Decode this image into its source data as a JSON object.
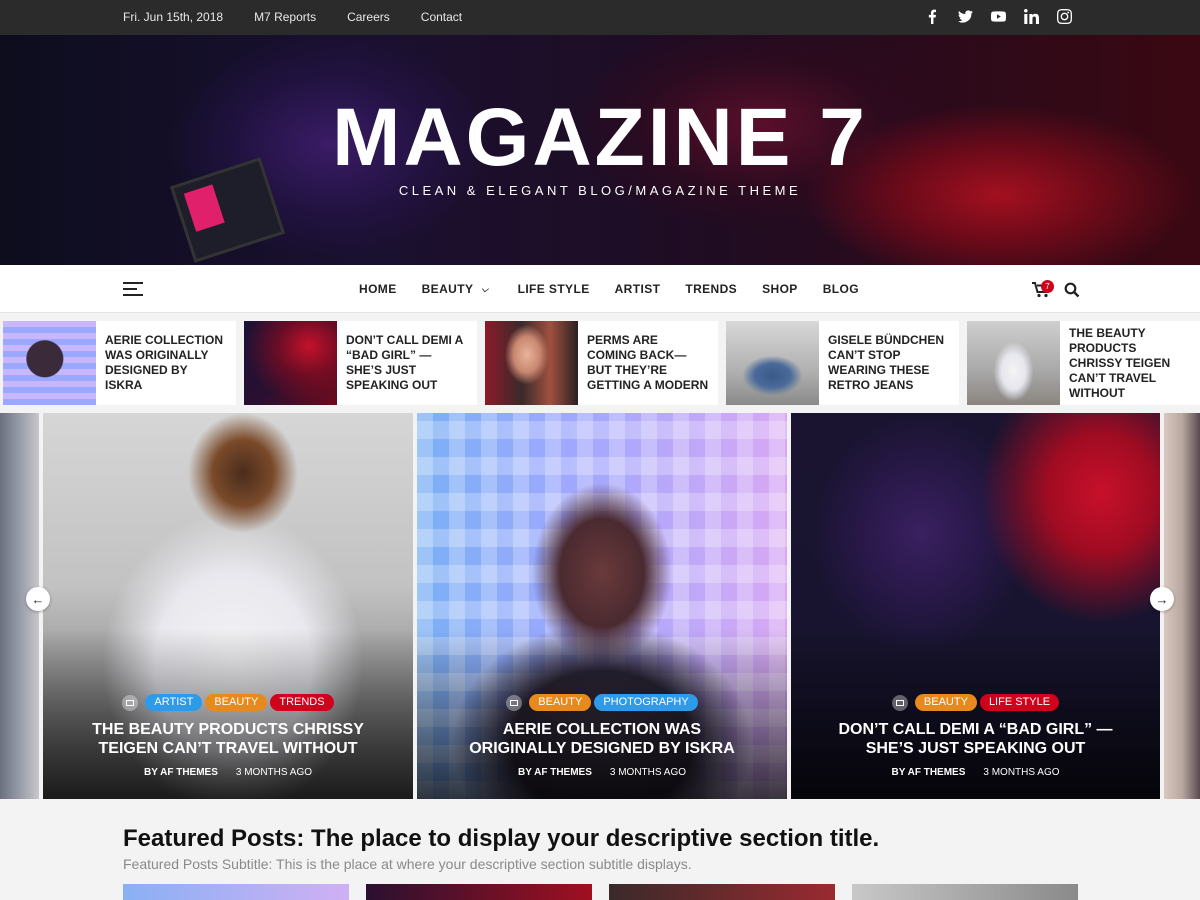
{
  "topbar": {
    "date": "Fri. Jun 15th, 2018",
    "links": [
      "M7 Reports",
      "Careers",
      "Contact"
    ],
    "social_icons": [
      "facebook-icon",
      "twitter-icon",
      "youtube-icon",
      "linkedin-icon",
      "instagram-icon"
    ]
  },
  "hero": {
    "title": "MAGAZINE 7",
    "tagline": "CLEAN & ELEGANT BLOG/MAGAZINE THEME"
  },
  "nav": {
    "items": [
      "HOME",
      "BEAUTY",
      "LIFE STYLE",
      "ARTIST",
      "TRENDS",
      "SHOP",
      "BLOG"
    ],
    "cart_count": "7"
  },
  "ticker": [
    {
      "title": "AERIE COLLECTION WAS ORIGINALLY DESIGNED BY ISKRA"
    },
    {
      "title": "DON’T CALL DEMI A “BAD GIRL” — SHE’S JUST SPEAKING OUT"
    },
    {
      "title": "PERMS ARE COMING BACK—BUT THEY’RE GETTING A MODERN"
    },
    {
      "title": "GISELE BÜNDCHEN CAN’T STOP WEARING THESE RETRO JEANS"
    },
    {
      "title": "THE BEAUTY PRODUCTS CHRISSY TEIGEN CAN’T TRAVEL WITHOUT"
    }
  ],
  "slides": [
    {
      "cats": [
        "ARTIST",
        "BEAUTY",
        "TRENDS"
      ],
      "title_lines": [
        "THE BEAUTY PRODUCTS CHRISSY",
        "TEIGEN CAN’T TRAVEL WITHOUT"
      ],
      "author": "BY AF THEMES",
      "time": "3 MONTHS AGO"
    },
    {
      "cats": [
        "BEAUTY",
        "PHOTOGRAPHY"
      ],
      "title_lines": [
        "AERIE COLLECTION WAS",
        "ORIGINALLY DESIGNED BY ISKRA"
      ],
      "author": "BY AF THEMES",
      "time": "3 MONTHS AGO"
    },
    {
      "cats": [
        "BEAUTY",
        "LIFE STYLE"
      ],
      "title_lines": [
        "DON’T CALL DEMI A “BAD GIRL” —",
        "SHE’S JUST SPEAKING OUT"
      ],
      "author": "BY AF THEMES",
      "time": "3 MONTHS AGO"
    }
  ],
  "colors": {
    "artist": "#2e9bea",
    "beauty": "#e8891c",
    "trends": "#d0021b",
    "photography": "#2e9bea",
    "lifestyle": "#d0021b"
  },
  "featured": {
    "title": "Featured Posts: The place to display your descriptive section title.",
    "subtitle": "Featured Posts Subtitle: This is the place at where your descriptive section subtitle displays."
  }
}
